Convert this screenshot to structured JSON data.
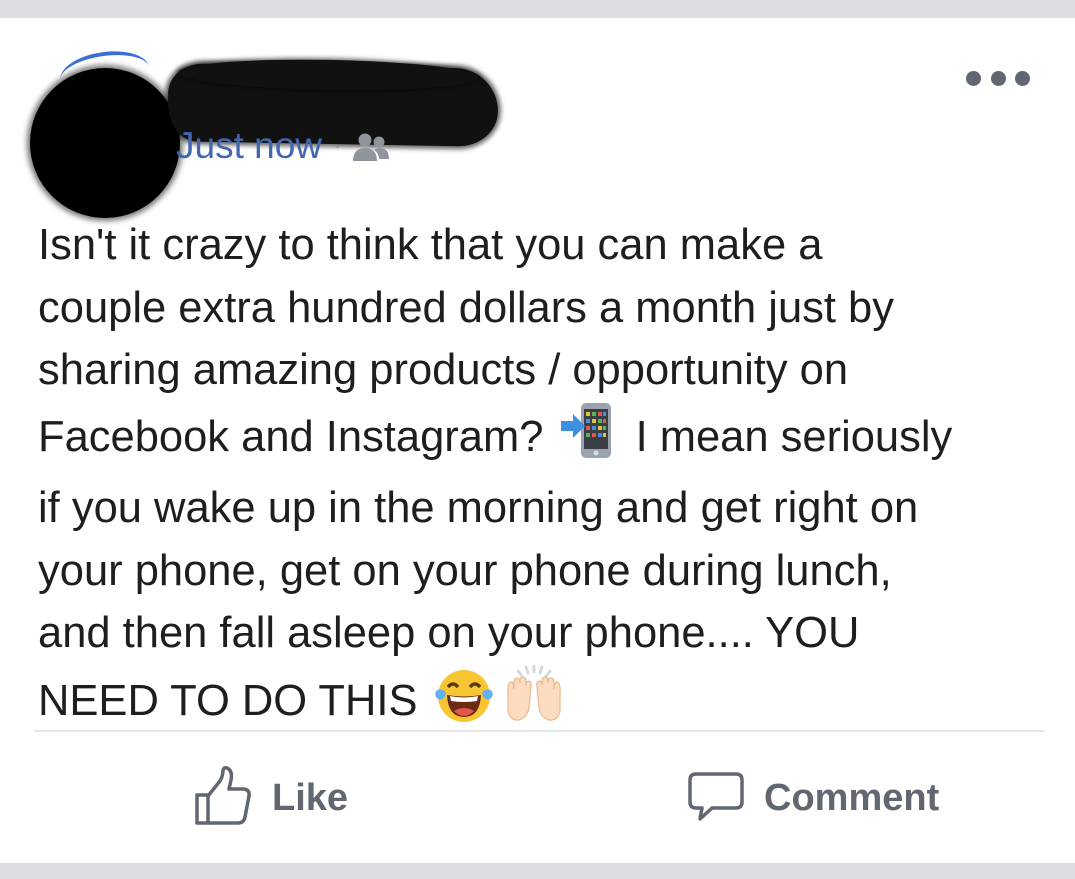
{
  "post": {
    "timestamp": "Just now",
    "meta_separator": "·",
    "audience_icon": "friends-icon",
    "more_icon": "more-horizontal-icon",
    "text_lines": [
      "Isn't it crazy to think that you can make a",
      "couple extra hundred dollars a month just by",
      "sharing amazing products / opportunity on",
      "Facebook and Instagram?",
      "I mean seriously",
      "if you wake up in the morning and get right on",
      "your phone, get on your phone during lunch,",
      "and then fall asleep on your phone.... YOU",
      "NEED TO DO THIS"
    ],
    "emojis": [
      "mobile-phone-arrow-emoji",
      "tears-of-joy-emoji",
      "raising-hands-emoji"
    ]
  },
  "actions": {
    "like_label": "Like",
    "like_icon": "thumbs-up-icon",
    "comment_label": "Comment",
    "comment_icon": "speech-bubble-icon"
  },
  "colors": {
    "link_blue": "#4267b2",
    "text": "#1c1e21",
    "secondary": "#606770",
    "background": "#dadde1"
  }
}
